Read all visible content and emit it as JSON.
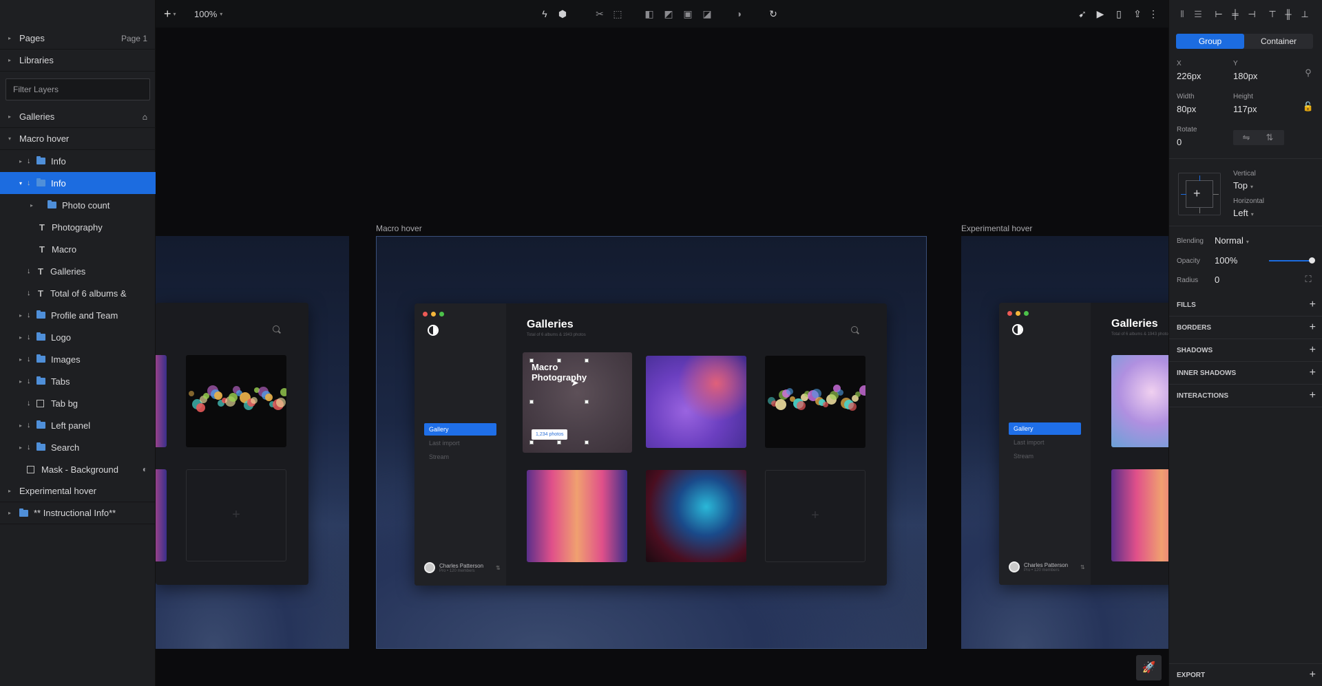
{
  "left_panel": {
    "pages_label": "Pages",
    "pages_value": "Page 1",
    "libraries_label": "Libraries",
    "filter_placeholder": "Filter Layers",
    "layers": [
      {
        "label": "Galleries",
        "indent": 0,
        "kind": "group"
      },
      {
        "label": "Macro hover",
        "indent": 0,
        "kind": "group"
      },
      {
        "label": "Info",
        "indent": 1,
        "kind": "folder"
      },
      {
        "label": "Info",
        "indent": 1,
        "kind": "folder"
      },
      {
        "label": "Photo count",
        "indent": 2,
        "kind": "folder"
      },
      {
        "label": "Photography",
        "indent": 2,
        "kind": "text"
      },
      {
        "label": "Macro",
        "indent": 2,
        "kind": "text"
      },
      {
        "label": "Galleries",
        "indent": 1,
        "kind": "text"
      },
      {
        "label": "Total of 6 albums &",
        "indent": 1,
        "kind": "text"
      },
      {
        "label": "Profile and Team",
        "indent": 1,
        "kind": "folder"
      },
      {
        "label": "Logo",
        "indent": 1,
        "kind": "folder"
      },
      {
        "label": "Images",
        "indent": 1,
        "kind": "folder"
      },
      {
        "label": "Tabs",
        "indent": 1,
        "kind": "folder"
      },
      {
        "label": "Tab bg",
        "indent": 1,
        "kind": "mask"
      },
      {
        "label": "Left panel",
        "indent": 1,
        "kind": "folder"
      },
      {
        "label": "Search",
        "indent": 1,
        "kind": "folder"
      },
      {
        "label": "Mask - Background",
        "indent": 1,
        "kind": "mask"
      },
      {
        "label": "Experimental hover",
        "indent": 0,
        "kind": "group"
      },
      {
        "label": "** Instructional Info**",
        "indent": 0,
        "kind": "folder"
      }
    ]
  },
  "toolbar": {
    "zoom": "100%"
  },
  "canvas": {
    "artboard_macro_label": "Macro hover",
    "artboard_experimental_label": "Experimental hover",
    "app": {
      "title": "Galleries",
      "subtitle": "Total of 6 albums & 1943 photos",
      "nav_selected": "Gallery",
      "nav_items": [
        "Last import",
        "Stream"
      ],
      "user_name": "Charles Patterson",
      "user_sub": "Pro • 120 members",
      "macro_title_line1": "Macro",
      "macro_title_line2": "Photography",
      "macro_badge": "1,234 photos"
    }
  },
  "inspector": {
    "tab_group": "Group",
    "tab_container": "Container",
    "x_label": "X",
    "x_value": "226px",
    "y_label": "Y",
    "y_value": "180px",
    "width_label": "Width",
    "width_value": "80px",
    "height_label": "Height",
    "height_value": "117px",
    "rotate_label": "Rotate",
    "rotate_value": "0",
    "vertical_label": "Vertical",
    "vertical_value": "Top",
    "horizontal_label": "Horizontal",
    "horizontal_value": "Left",
    "blending_label": "Blending",
    "blending_value": "Normal",
    "opacity_label": "Opacity",
    "opacity_value": "100%",
    "opacity_fraction": 1.0,
    "radius_label": "Radius",
    "radius_value": "0",
    "sections": [
      "FILLS",
      "BORDERS",
      "SHADOWS",
      "INNER SHADOWS",
      "INTERACTIONS"
    ],
    "export_label": "EXPORT"
  },
  "colors": {
    "accent": "#1c6ce0",
    "panel_bg": "#1e1f22",
    "canvas_bg": "#0b0b0d",
    "dot_red": "#ed5a55",
    "dot_yellow": "#f4b63b",
    "dot_green": "#4cc24a"
  }
}
